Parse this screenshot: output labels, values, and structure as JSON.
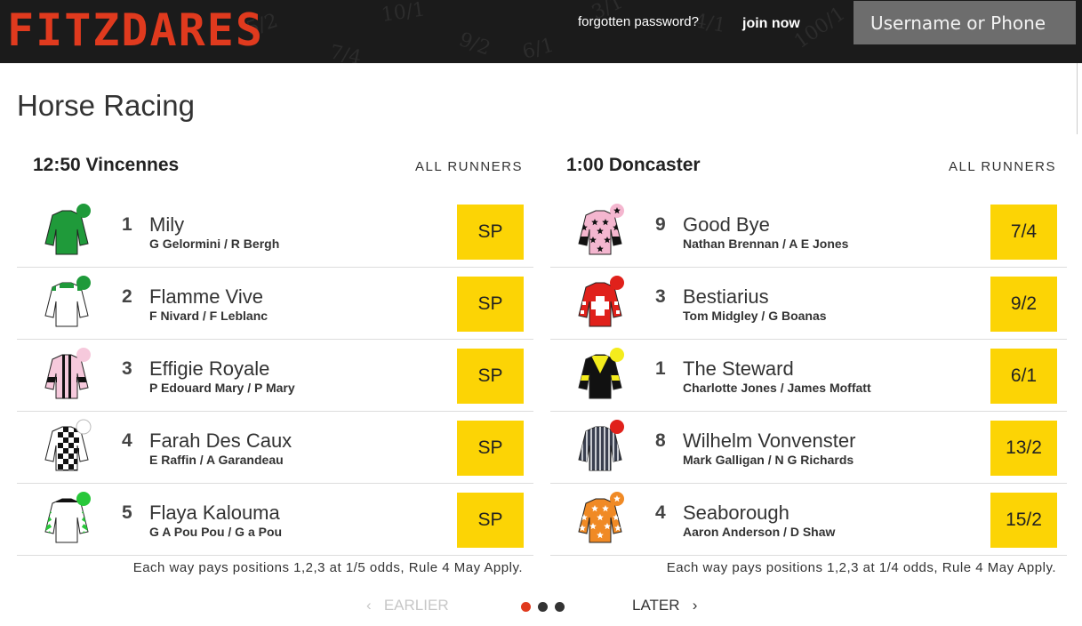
{
  "header": {
    "logo": "FITZDARES",
    "forgot_password": "forgotten password?",
    "join_now": "join now",
    "login_placeholder": "Username or Phone",
    "background_odds": [
      "5/2",
      "7/4",
      "10/1",
      "9/2",
      "100/1",
      "6/1",
      "4/1",
      "3/1"
    ]
  },
  "page_title": "Horse Racing",
  "races": [
    {
      "title": "12:50 Vincennes",
      "all_runners": "ALL RUNNERS",
      "rule": "Each way pays positions 1,2,3 at 1/5 odds, Rule 4 May Apply.",
      "runners": [
        {
          "number": "1",
          "name": "Mily",
          "jockey": "G Gelormini / R Bergh",
          "odds": "SP",
          "silk": {
            "body": "#1f9a3a",
            "cap": "#1f9a3a",
            "pattern": "plain"
          }
        },
        {
          "number": "2",
          "name": "Flamme Vive",
          "jockey": "F Nivard / F Leblanc",
          "odds": "SP",
          "silk": {
            "body": "#ffffff",
            "cap": "#1f9a3a",
            "pattern": "collar-green"
          }
        },
        {
          "number": "3",
          "name": "Effigie Royale",
          "jockey": "P Edouard Mary / P Mary",
          "odds": "SP",
          "silk": {
            "body": "#f6c9dc",
            "cap": "#f6c9dc",
            "pattern": "stripes-black"
          }
        },
        {
          "number": "4",
          "name": "Farah Des Caux",
          "jockey": "E Raffin / A Garandeau",
          "odds": "SP",
          "silk": {
            "body": "#ffffff",
            "cap": "#ffffff",
            "pattern": "checks"
          }
        },
        {
          "number": "5",
          "name": "Flaya Kalouma",
          "jockey": "G A Pou Pou / G a Pou",
          "odds": "SP",
          "silk": {
            "body": "#ffffff",
            "cap": "#28c83a",
            "pattern": "chevrons-green"
          }
        }
      ]
    },
    {
      "title": "1:00 Doncaster",
      "all_runners": "ALL RUNNERS",
      "rule": "Each way pays positions 1,2,3 at 1/4 odds, Rule 4 May Apply.",
      "runners": [
        {
          "number": "9",
          "name": "Good Bye",
          "jockey": "Nathan Brennan / A E Jones",
          "odds": "7/4",
          "silk": {
            "body": "#f4b6cf",
            "cap": "#f4b6cf",
            "pattern": "stars-black"
          }
        },
        {
          "number": "3",
          "name": "Bestiarius",
          "jockey": "Tom Midgley / G Boanas",
          "odds": "9/2",
          "silk": {
            "body": "#e0211b",
            "cap": "#e0211b",
            "pattern": "cross-white"
          }
        },
        {
          "number": "1",
          "name": "The Steward",
          "jockey": "Charlotte Jones / James Moffatt",
          "odds": "6/1",
          "silk": {
            "body": "#111111",
            "cap": "#f4ec1c",
            "pattern": "yellow-vee"
          }
        },
        {
          "number": "8",
          "name": "Wilhelm Vonvenster",
          "jockey": "Mark Galligan / N G Richards",
          "odds": "13/2",
          "silk": {
            "body": "#3a4050",
            "cap": "#e0211b",
            "pattern": "stripes-grey"
          }
        },
        {
          "number": "4",
          "name": "Seaborough",
          "jockey": "Aaron Anderson / D Shaw",
          "odds": "15/2",
          "silk": {
            "body": "#f08a25",
            "cap": "#f08a25",
            "pattern": "stars-white"
          }
        }
      ]
    }
  ],
  "pager": {
    "earlier": "EARLIER",
    "later": "LATER",
    "dots": [
      {
        "color": "#e03a1e",
        "active": true
      },
      {
        "color": "#333333",
        "active": false
      },
      {
        "color": "#333333",
        "active": false
      }
    ]
  }
}
